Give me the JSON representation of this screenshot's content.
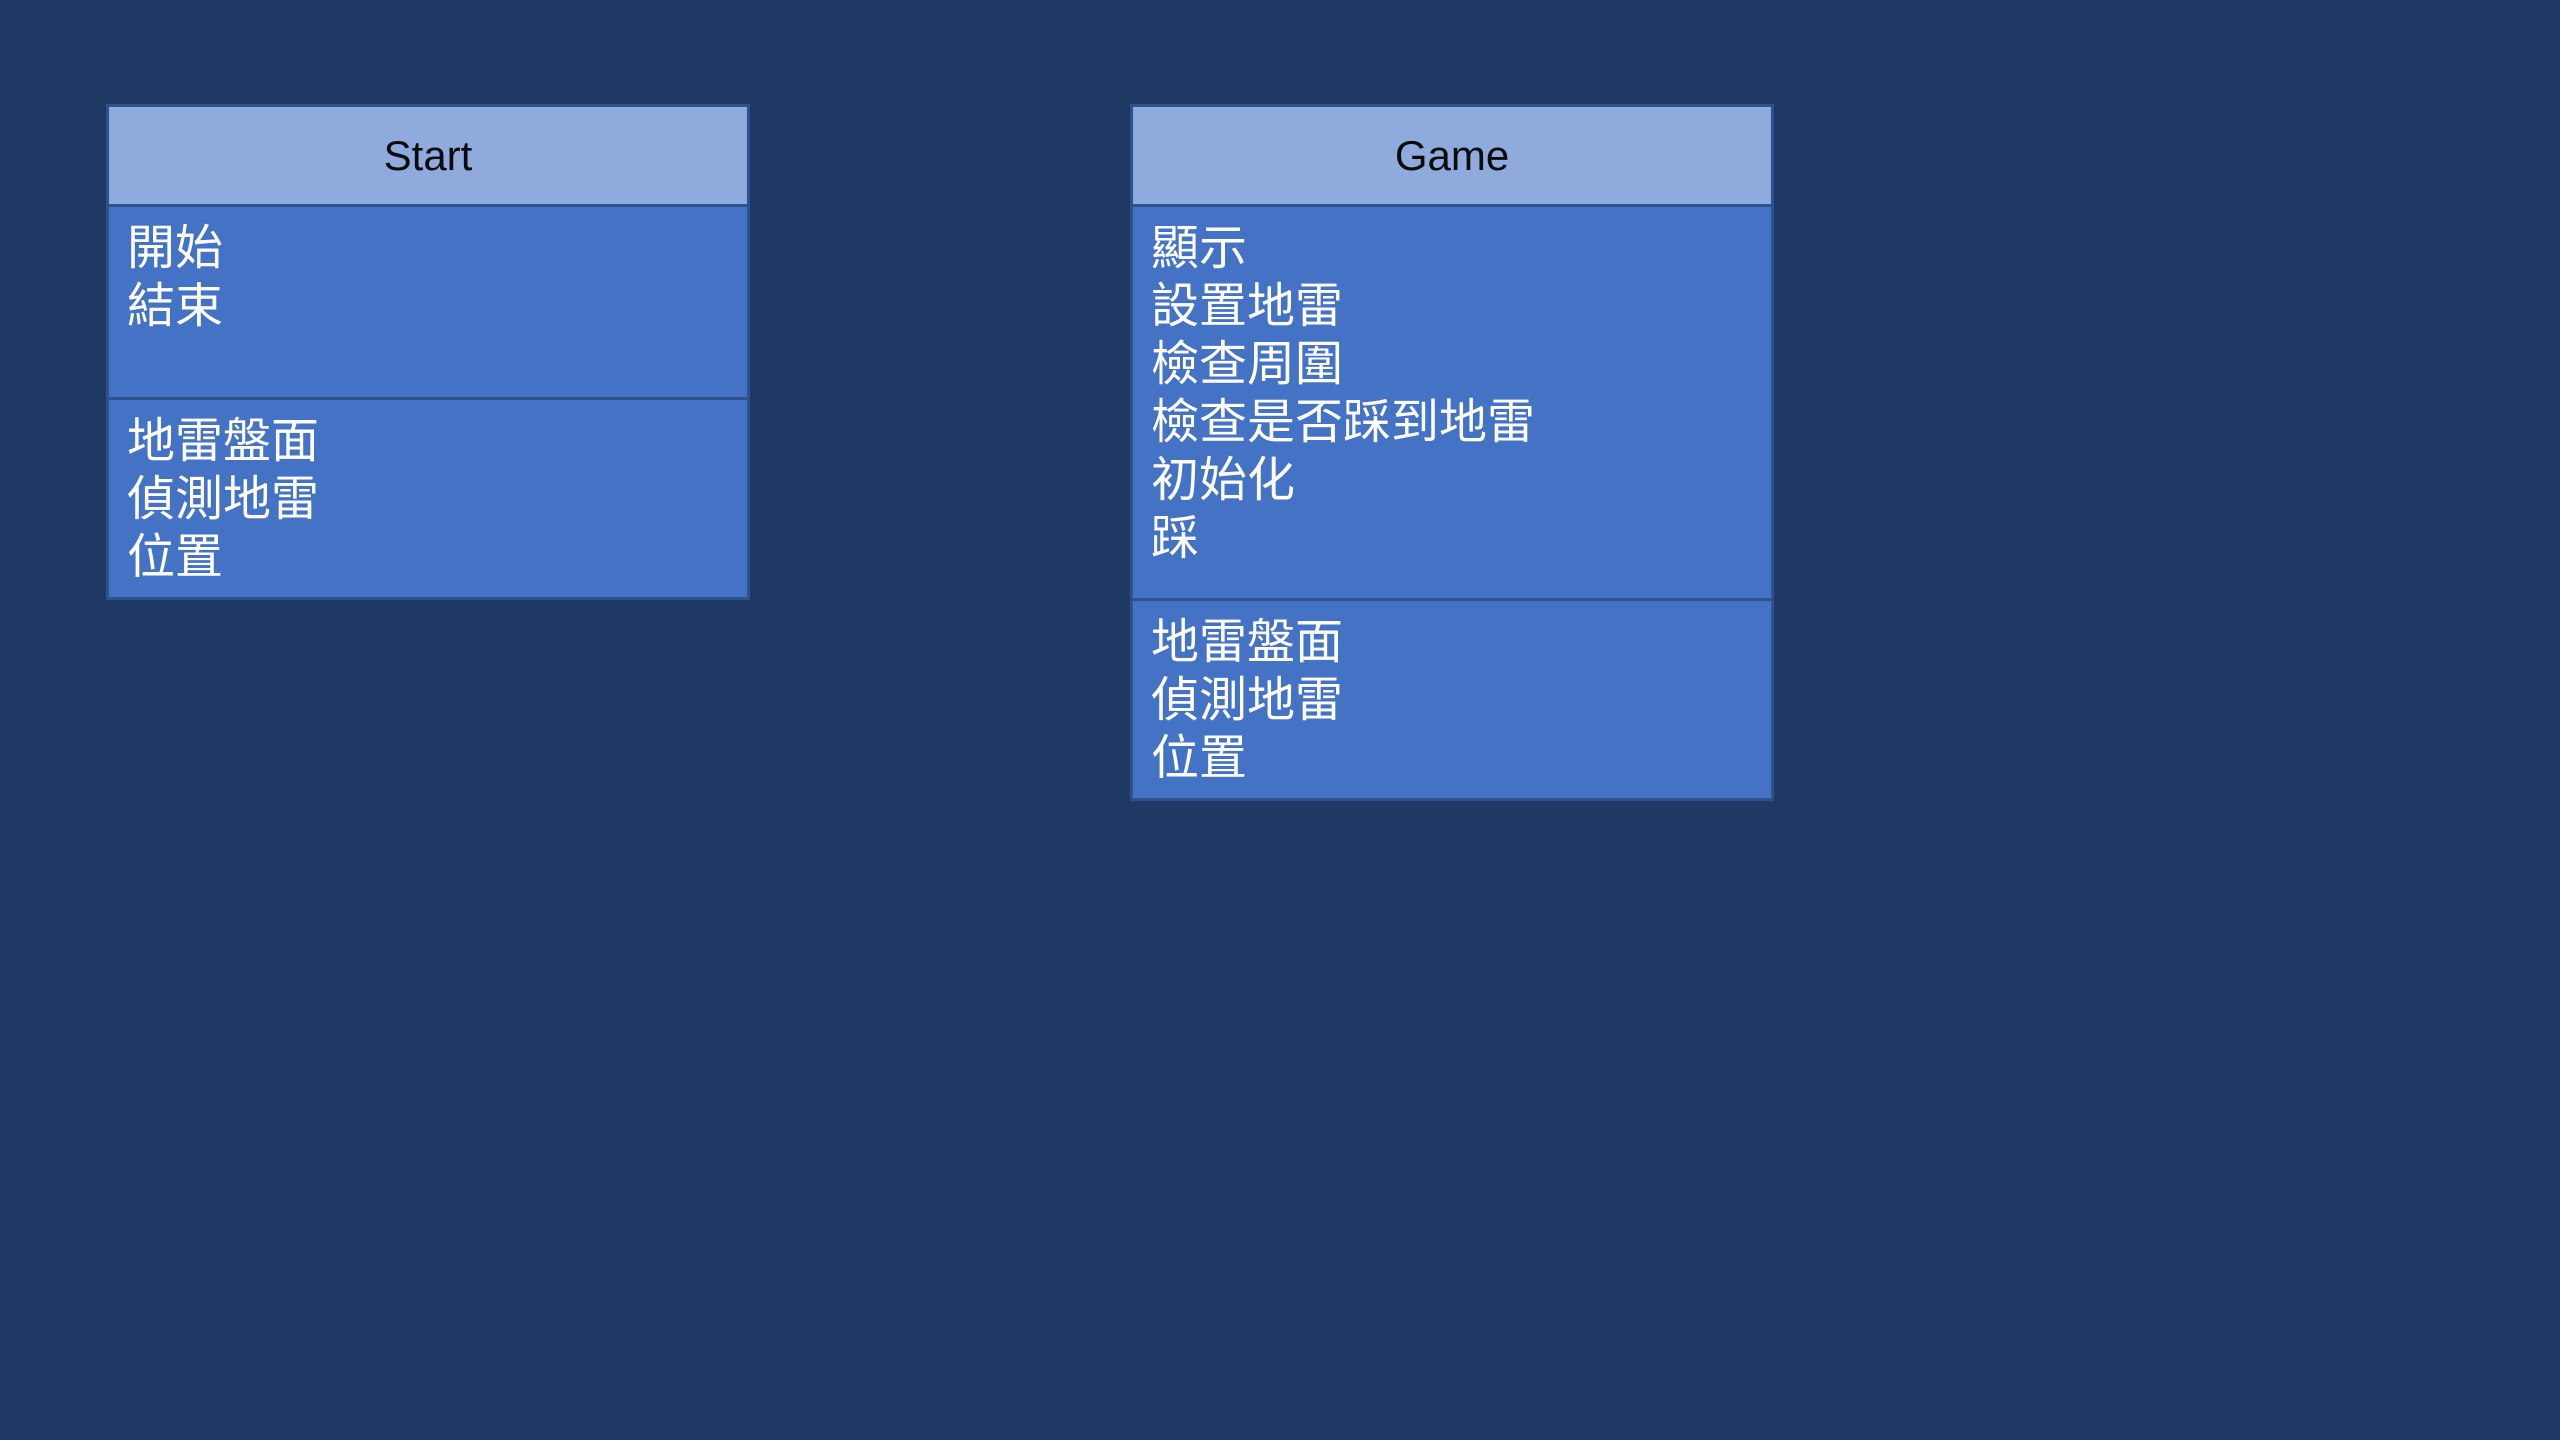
{
  "classes": [
    {
      "name": "Start",
      "methods": [
        "開始",
        "結束"
      ],
      "attributes": [
        "地雷盤面",
        "偵測地雷",
        "位置"
      ]
    },
    {
      "name": "Game",
      "methods": [
        "顯示",
        "設置地雷",
        "檢查周圍",
        "檢查是否踩到地雷",
        "初始化",
        "踩"
      ],
      "attributes": [
        "地雷盤面",
        "偵測地雷",
        "位置"
      ]
    }
  ],
  "colors": {
    "background": "#203864",
    "header_fill": "#8faadc",
    "body_fill": "#4472c4",
    "border": "#2f528f",
    "header_text": "#0b0b0b",
    "body_text": "#ffffff"
  }
}
